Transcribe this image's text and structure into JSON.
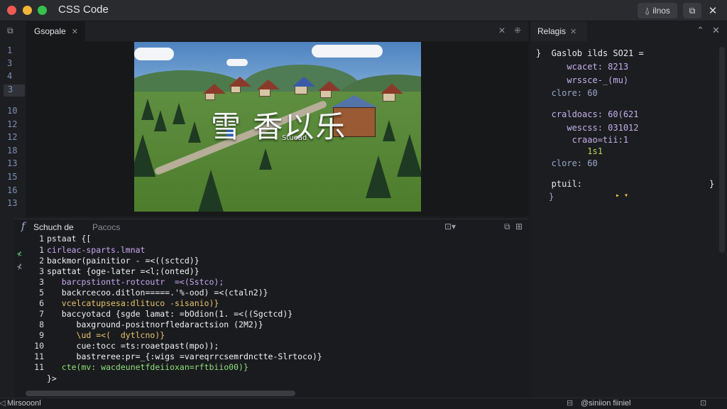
{
  "window": {
    "title": "CSS Code"
  },
  "titlebar": {
    "share_label": "ilnos"
  },
  "gutter_lines": [
    "1",
    "3",
    "4",
    "3",
    "10",
    "12",
    "12",
    "18",
    "13",
    "15",
    "16",
    "13"
  ],
  "editor": {
    "tab_label": "Gsopale",
    "preview": {
      "overlay_title": "雪 香以乐",
      "overlay_sub": "Stuoad"
    }
  },
  "code_panel": {
    "tab_active": "Schuch de",
    "tab_inactive": "Pacocs",
    "lines": [
      {
        "num": "1",
        "text": "pstaat {["
      },
      {
        "num": "1",
        "text": "cirleac-sparts.lmnat"
      },
      {
        "num": "2",
        "text": "backmor(painitior - =<((sctcd)}"
      },
      {
        "num": "3",
        "text": "spattat {oge-later =<l;(onted)}"
      },
      {
        "num": "3",
        "text": "   barcpstiontt-rotcoutr  =<(Sstco);"
      },
      {
        "num": "5",
        "text": "   backrcecoo.ditlon=====.'%-ood) =<(ctaln2)}"
      },
      {
        "num": "6",
        "text": "   vcelcatupsesa:dlituco -sisanio)}"
      },
      {
        "num": "7",
        "text": "   baccyotacd {sgde lamat: =bOdion(1. =<((Sgctcd)}"
      },
      {
        "num": "8",
        "text": "      baxground-positnorfledaractsion (2M2)}"
      },
      {
        "num": "9",
        "text": "      \\ud =<(  dytlcno)}"
      },
      {
        "num": "10",
        "text": "      cue:tocc =ts:roaetpast(mpo));"
      },
      {
        "num": "11",
        "text": "      bastreree:pr=_{:wigs =vareqrrcsemrdnctte-Slrtoco)}"
      },
      {
        "num": "11",
        "text": "   cte(mv: wacdeunetfdeiioxan=rftbiio00)}"
      },
      {
        "num": "",
        "text": "}>"
      }
    ]
  },
  "right_panel": {
    "tab_label": "Relagis",
    "lines": [
      {
        "text": "}  Gaslob ilds SO21 ="
      },
      {
        "text": "      wcacet: 8213"
      },
      {
        "text": "      wrssce-_(mu)"
      },
      {
        "text": "   clore: 60"
      },
      {
        "text": "   craldoacs: 60(621"
      },
      {
        "text": "      wescss: 031012"
      },
      {
        "text": "       craao=tii:1"
      },
      {
        "text": "          1s1"
      },
      {
        "text": "   clore: 60"
      },
      {
        "text": "   ptuil:"
      },
      {
        "text": "}"
      },
      {
        "text": "}"
      }
    ]
  },
  "status": {
    "left": "Mirsooonl",
    "right": "@siniion fiiniel"
  }
}
